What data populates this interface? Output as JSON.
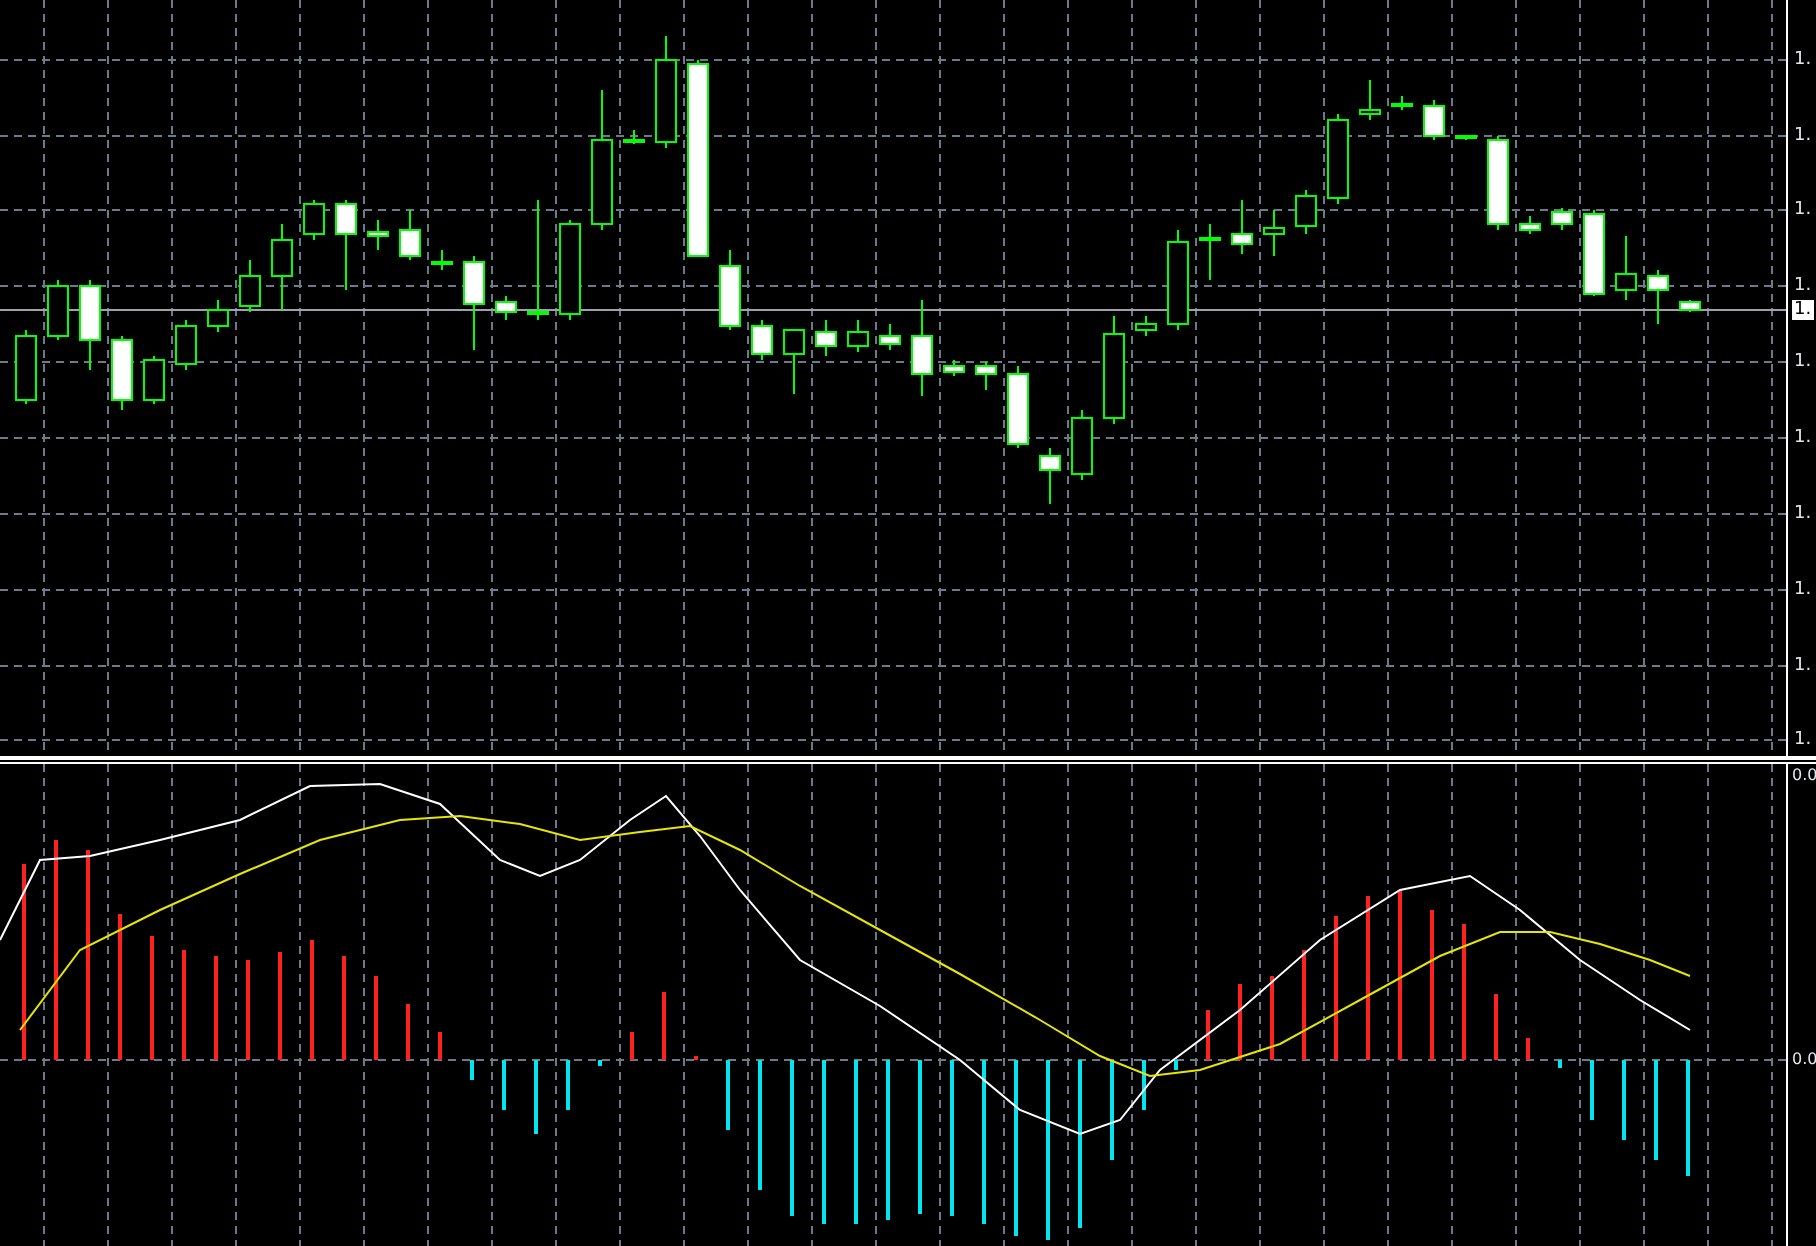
{
  "price_chart": {
    "axis_labels": [
      "1.",
      "1.",
      "1.",
      "1.",
      "1.",
      "1.",
      "1.",
      "1.",
      "1.",
      "1."
    ],
    "current_price_tag": "1."
  },
  "indicator": {
    "axis_labels": [
      "0.0",
      "0.0"
    ]
  }
}
